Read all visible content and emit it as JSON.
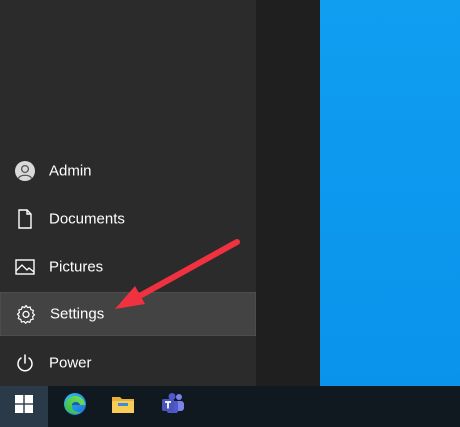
{
  "start_menu": {
    "user": {
      "label": "Admin",
      "icon": "user-avatar-icon"
    },
    "items": [
      {
        "label": "Documents",
        "icon": "document-icon"
      },
      {
        "label": "Pictures",
        "icon": "picture-icon"
      },
      {
        "label": "Settings",
        "icon": "gear-icon",
        "selected": true
      },
      {
        "label": "Power",
        "icon": "power-icon"
      }
    ]
  },
  "taskbar": {
    "start_icon": "windows-logo-icon",
    "apps": [
      {
        "name": "Microsoft Edge",
        "icon": "edge-icon"
      },
      {
        "name": "File Explorer",
        "icon": "folder-icon"
      },
      {
        "name": "Microsoft Teams",
        "icon": "teams-icon"
      }
    ]
  },
  "colors": {
    "desktop_blue": "#0b97ec",
    "menu_background": "#2b2b2b",
    "selected_background": "#434343",
    "taskbar": "#101820",
    "annotation_arrow": "#f0313f"
  }
}
